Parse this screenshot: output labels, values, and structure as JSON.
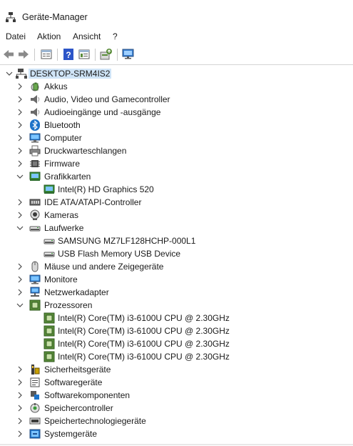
{
  "window": {
    "title": "Geräte-Manager",
    "title_icon": "device-manager-icon"
  },
  "menu": [
    "Datei",
    "Aktion",
    "Ansicht",
    "?"
  ],
  "toolbar": [
    "back-icon",
    "forward-icon",
    "properties-icon",
    "help-icon",
    "view-icon",
    "update-driver-icon",
    "scan-hardware-icon"
  ],
  "tree": {
    "root": "DESKTOP-SRM4IS2",
    "categories": [
      {
        "label": "Akkus",
        "icon": "battery-icon",
        "expanded": false
      },
      {
        "label": "Audio, Video und Gamecontroller",
        "icon": "speaker-icon",
        "expanded": false
      },
      {
        "label": "Audioeingänge und -ausgänge",
        "icon": "speaker-icon",
        "expanded": false
      },
      {
        "label": "Bluetooth",
        "icon": "bluetooth-icon",
        "expanded": false
      },
      {
        "label": "Computer",
        "icon": "computer-icon",
        "expanded": false
      },
      {
        "label": "Druckwarteschlangen",
        "icon": "printer-icon",
        "expanded": false
      },
      {
        "label": "Firmware",
        "icon": "chip-icon",
        "expanded": false
      },
      {
        "label": "Grafikkarten",
        "icon": "display-adapter-icon",
        "expanded": true,
        "children": [
          {
            "label": "Intel(R) HD Graphics 520",
            "icon": "display-adapter-icon"
          }
        ]
      },
      {
        "label": "IDE ATA/ATAPI-Controller",
        "icon": "ide-controller-icon",
        "expanded": false
      },
      {
        "label": "Kameras",
        "icon": "camera-icon",
        "expanded": false
      },
      {
        "label": "Laufwerke",
        "icon": "drive-icon",
        "expanded": true,
        "children": [
          {
            "label": "SAMSUNG MZ7LF128HCHP-000L1",
            "icon": "drive-icon"
          },
          {
            "label": "USB Flash Memory USB Device",
            "icon": "drive-icon"
          }
        ]
      },
      {
        "label": "Mäuse und andere Zeigegeräte",
        "icon": "mouse-icon",
        "expanded": false
      },
      {
        "label": "Monitore",
        "icon": "monitor-icon",
        "expanded": false
      },
      {
        "label": "Netzwerkadapter",
        "icon": "network-adapter-icon",
        "expanded": false
      },
      {
        "label": "Prozessoren",
        "icon": "processor-icon",
        "expanded": true,
        "children": [
          {
            "label": "Intel(R) Core(TM) i3-6100U CPU @ 2.30GHz",
            "icon": "processor-icon"
          },
          {
            "label": "Intel(R) Core(TM) i3-6100U CPU @ 2.30GHz",
            "icon": "processor-icon"
          },
          {
            "label": "Intel(R) Core(TM) i3-6100U CPU @ 2.30GHz",
            "icon": "processor-icon"
          },
          {
            "label": "Intel(R) Core(TM) i3-6100U CPU @ 2.30GHz",
            "icon": "processor-icon"
          }
        ]
      },
      {
        "label": "Sicherheitsgeräte",
        "icon": "security-device-icon",
        "expanded": false
      },
      {
        "label": "Softwaregeräte",
        "icon": "software-device-icon",
        "expanded": false
      },
      {
        "label": "Softwarekomponenten",
        "icon": "software-component-icon",
        "expanded": false
      },
      {
        "label": "Speichercontroller",
        "icon": "storage-controller-icon",
        "expanded": false
      },
      {
        "label": "Speichertechnologiegeräte",
        "icon": "storage-tech-icon",
        "expanded": false
      },
      {
        "label": "Systemgeräte",
        "icon": "system-device-icon",
        "expanded": false
      }
    ]
  },
  "colors": {
    "selection": "#cfe4f7",
    "accent": "#1e73c8",
    "processor_green": "#5a8c3a"
  }
}
